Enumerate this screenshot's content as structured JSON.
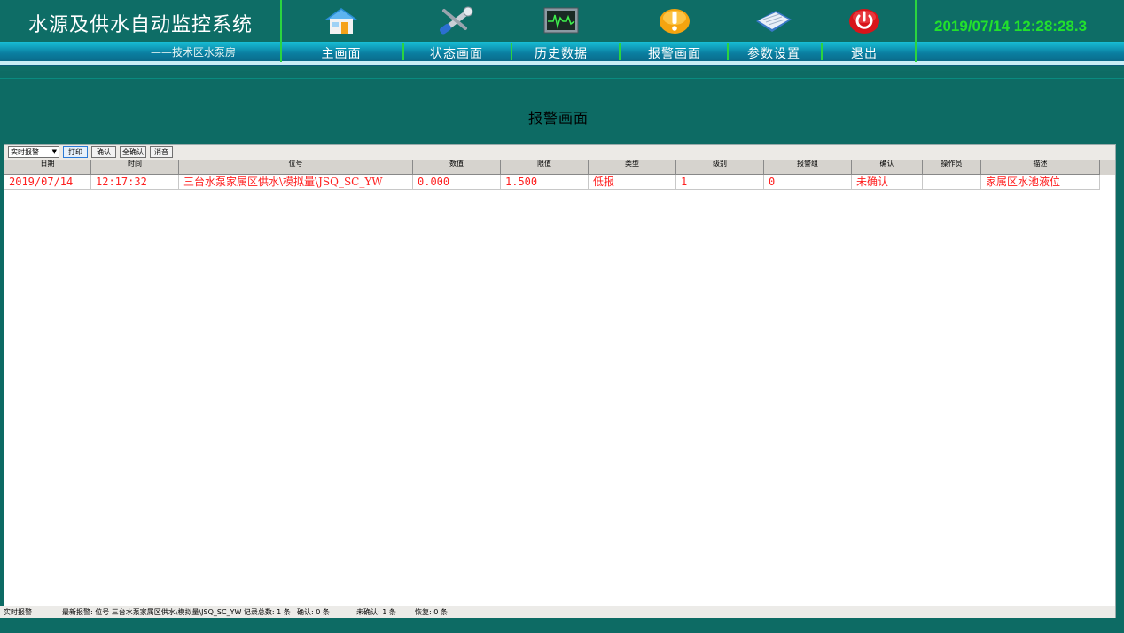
{
  "app": {
    "title": "水源及供水自动监控系统",
    "subtitle": "——技术区水泵房",
    "clock": "2019/07/14 12:28:28.3"
  },
  "nav": [
    {
      "label": "主画面",
      "icon": "house-icon"
    },
    {
      "label": "状态画面",
      "icon": "wrench-screwdriver-icon"
    },
    {
      "label": "历史数据",
      "icon": "monitor-waveform-icon"
    },
    {
      "label": "报警画面",
      "icon": "warning-icon"
    },
    {
      "label": "参数设置",
      "icon": "keyboard-icon"
    },
    {
      "label": "退出",
      "icon": "power-icon"
    }
  ],
  "page": {
    "heading": "报警画面"
  },
  "toolbar": {
    "mode_select": "实时报警",
    "print": "打印",
    "confirm": "确认",
    "confirm_all": "全确认",
    "silence": "消音"
  },
  "table": {
    "columns": [
      "日期",
      "时间",
      "位号",
      "数值",
      "限值",
      "类型",
      "级别",
      "报警组",
      "确认",
      "操作员",
      "描述"
    ],
    "rows": [
      [
        "2019/07/14",
        "12:17:32",
        "三台水泵家属区供水\\模拟量\\JSQ_SC_YW",
        "0.000",
        "1.500",
        "低报",
        "1",
        "0",
        "未确认",
        "",
        "家属区水池液位"
      ]
    ]
  },
  "status": {
    "mode": "实时报警",
    "latest": "最新报警: 位号 三台水泵家属区供水\\模拟量\\JSQ_SC_YW 记录总数: 1 条",
    "confirmed": "确认: 0 条",
    "unconfirmed": "未确认: 1 条",
    "recovered": "恢复: 0 条"
  },
  "colors": {
    "background": "#0d6b64",
    "clock": "#22e12c",
    "alarm_text": "#ff2020",
    "nav_bar": "#0a7ea0"
  }
}
